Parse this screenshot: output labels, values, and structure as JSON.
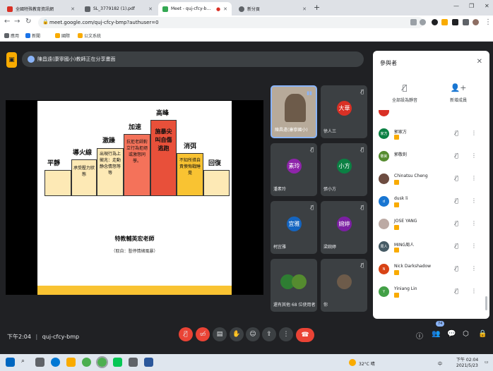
{
  "browser": {
    "tabs": [
      {
        "title": "全國特殊教育資訊網",
        "color": "#d93025",
        "active": false
      },
      {
        "title": "SL_3779182 (1).pdf",
        "color": "#5f6368",
        "active": false
      },
      {
        "title": "Meet - quj-cfcy-bmp",
        "color": "#34a853",
        "active": true
      },
      {
        "title": "新分頁",
        "color": "#5f6368",
        "active": false
      }
    ],
    "new_tab": "+",
    "url": "meet.google.com/quj-cfcy-bmp?authuser=0",
    "bookmarks": [
      "應用",
      "新聞",
      "國際",
      "公文系統"
    ]
  },
  "meet": {
    "presenting_text": "陳昌遠(康寧國小)教師正在分享畫面",
    "slide": {
      "steps": [
        {
          "label": "平靜",
          "text": ""
        },
        {
          "label": "導火線",
          "text": "承受壓力狀態"
        },
        {
          "label": "激躁",
          "text": "出現行為上徵兆：走動静念情怒等等"
        },
        {
          "label": "加速",
          "text": "抗拒老師對立行為拒絕或激怒同學。"
        },
        {
          "label": "高峰",
          "text": "施暴尖叫自傷逃跑"
        },
        {
          "label": "消弭",
          "text": "不知所措自責懊悔戰睡覺"
        },
        {
          "label": "回復",
          "text": ""
        }
      ],
      "author": "特教輔英宏老師",
      "source": "（取自：暫停情緒風暴）"
    },
    "tiles": [
      {
        "name": "陳昌遠(康寧國小)",
        "initial": "",
        "color": "#8a7f72"
      },
      {
        "name": "徐人三",
        "initial": "大華",
        "color": "#d93025"
      },
      {
        "name": "潘素玲",
        "initial": "素玲",
        "color": "#8e24aa"
      },
      {
        "name": "張小方",
        "initial": "小方",
        "color": "#0b8043"
      },
      {
        "name": "柯宜雅",
        "initial": "宜雅",
        "color": "#1565c0"
      },
      {
        "name": "梁婉婷",
        "initial": "婉婷",
        "color": "#7b1fa2"
      },
      {
        "name": "還有其他 68 位使用者",
        "initial": "",
        "color": "#3c4043"
      },
      {
        "name": "你",
        "initial": "",
        "color": "#6d5b4a"
      }
    ],
    "time": "下午2:04",
    "meeting_code": "quj-cfcy-bmp",
    "participant_count": "74"
  },
  "panel": {
    "title": "參與者",
    "mute_all": "全部設為靜音",
    "add_people": "新增成員",
    "people": [
      {
        "name": "",
        "initial": "",
        "color": "#d93025"
      },
      {
        "name": "郭家方",
        "initial": "家方",
        "color": "#0b8043"
      },
      {
        "name": "郭敬釗",
        "initial": "敬釗",
        "color": "#558b2f"
      },
      {
        "name": "Chinatsu Cheng",
        "initial": "",
        "color": "#6d4c41"
      },
      {
        "name": "dusk li",
        "initial": "d",
        "color": "#1976d2"
      },
      {
        "name": "JOSE YANG",
        "initial": "",
        "color": "#bcaaa4"
      },
      {
        "name": "MING周人",
        "initial": "周人",
        "color": "#455a64"
      },
      {
        "name": "Nick Darkshadow",
        "initial": "N",
        "color": "#d84315"
      },
      {
        "name": "Yiniang Lin",
        "initial": "Y",
        "color": "#43a047"
      }
    ]
  },
  "taskbar": {
    "weather": "32°C 晴",
    "lang": "中",
    "clock_time": "下午 02:04",
    "clock_date": "2021/5/23"
  }
}
